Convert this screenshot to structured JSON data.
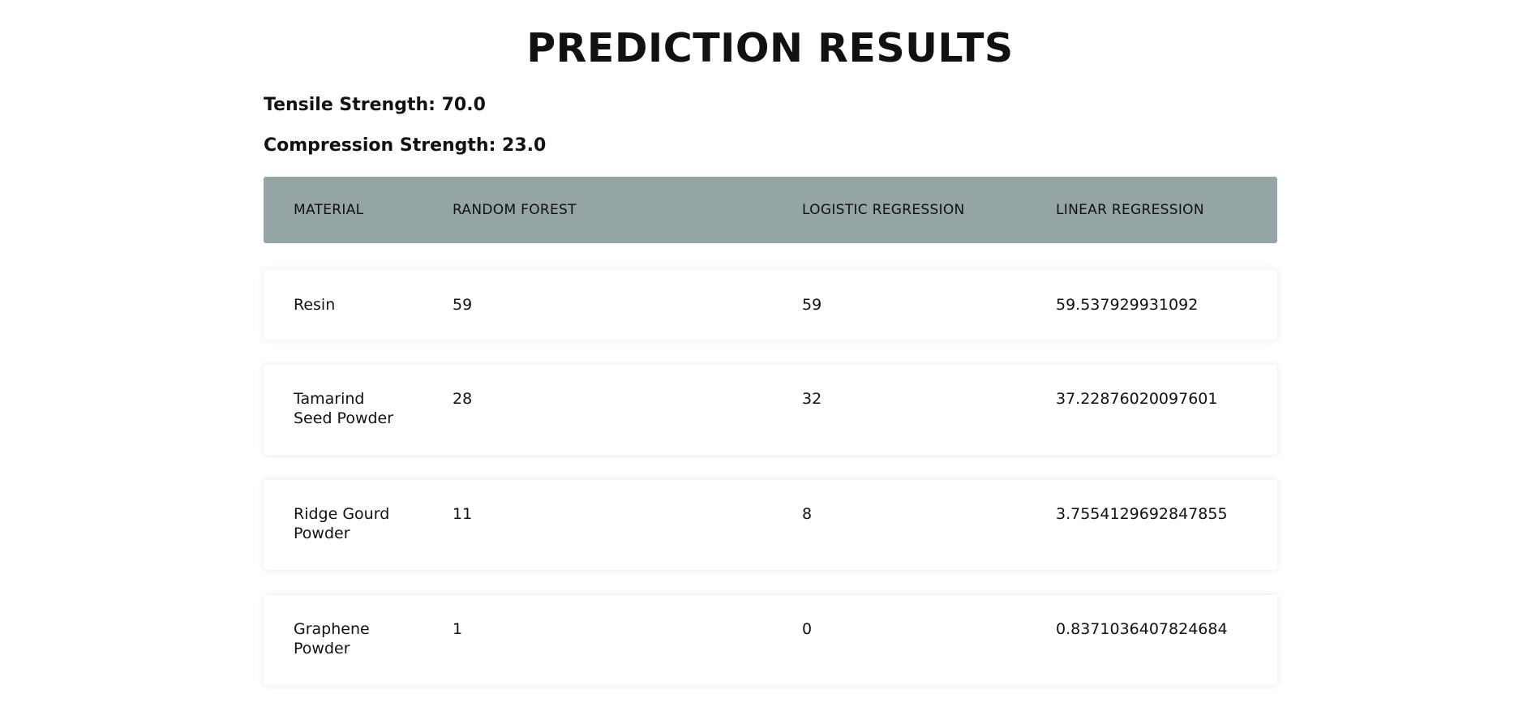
{
  "page": {
    "title": "PREDICTION RESULTS",
    "tensile_strength": "Tensile Strength: 70.0",
    "compression_strength": "Compression Strength: 23.0"
  },
  "table": {
    "headers": [
      "MATERIAL",
      "RANDOM FOREST",
      "LOGISTIC REGRESSION",
      "LINEAR REGRESSION"
    ],
    "rows": [
      [
        "Resin",
        "59",
        "59",
        "59.537929931092"
      ],
      [
        "Tamarind Seed Powder",
        "28",
        "32",
        "37.22876020097601"
      ],
      [
        "Ridge Gourd Powder",
        "11",
        "8",
        "3.7554129692847855"
      ],
      [
        "Graphene Powder",
        "1",
        "0",
        "0.8371036407824684"
      ]
    ]
  },
  "colors": {
    "header_bg": "#95a5a6",
    "row_bg": "#ffffff",
    "text": "#111111"
  }
}
